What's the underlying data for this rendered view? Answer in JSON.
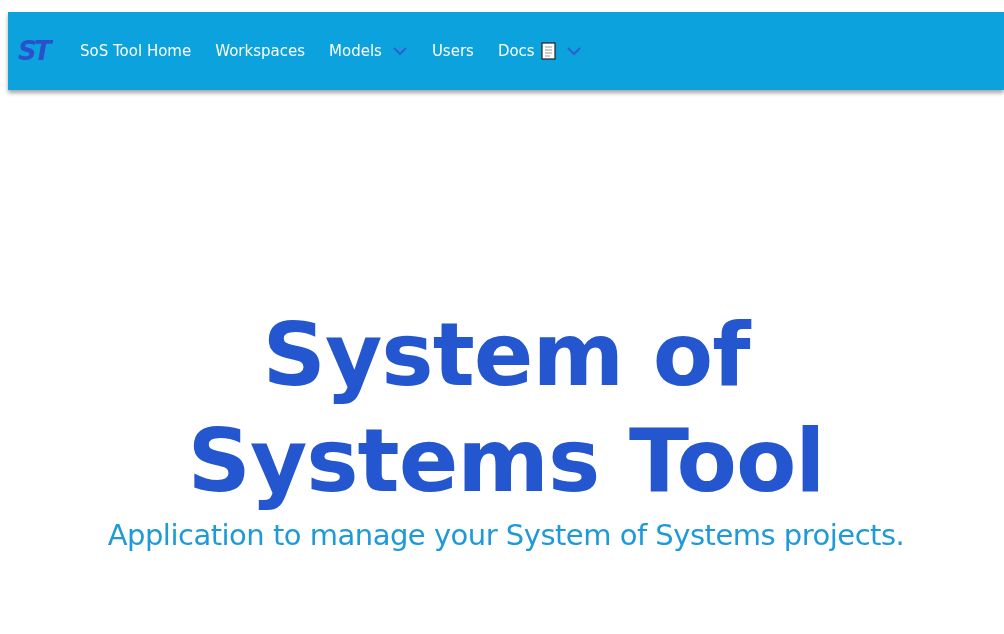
{
  "navbar": {
    "logo": "ST",
    "items": [
      {
        "label": "SoS Tool Home",
        "kind": "link"
      },
      {
        "label": "Workspaces",
        "kind": "link"
      },
      {
        "label": "Models",
        "kind": "dropdown"
      },
      {
        "label": "Users",
        "kind": "link"
      },
      {
        "label": "Docs",
        "kind": "doc-dropdown"
      }
    ]
  },
  "hero": {
    "title": "System of Systems Tool",
    "subtitle": "Application to manage your System of Systems projects."
  }
}
